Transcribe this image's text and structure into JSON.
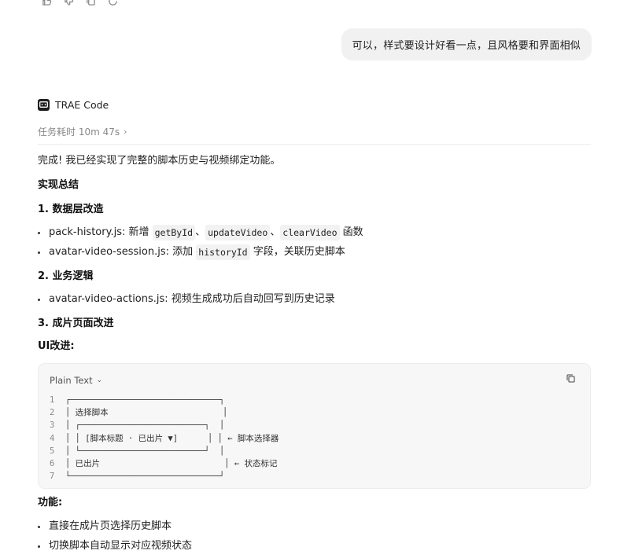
{
  "user_message": "可以，样式要设计好看一点，且风格要和界面相似",
  "assistant": {
    "brand_name": "TRAE Code",
    "duration": "任务耗时 10m 47s",
    "intro": "完成! 我已经实现了完整的脚本历史与视频绑定功能。",
    "summary_heading": "实现总结",
    "sections": {
      "data_layer": {
        "heading": "1. 数据层改造",
        "item1_file": "pack-history.js:",
        "item1_text_a": " 新增 ",
        "item1_code1": "getById",
        "item1_sep1": "、",
        "item1_code2": "updateVideo",
        "item1_sep2": "、",
        "item1_code3": "clearVideo",
        "item1_text_b": " 函数",
        "item2_file": "avatar-video-session.js:",
        "item2_text_a": " 添加 ",
        "item2_code": "historyId",
        "item2_text_b": " 字段，关联历史脚本"
      },
      "logic": {
        "heading": "2. 业务逻辑",
        "item1_file": "avatar-video-actions.js:",
        "item1_text": " 视频生成成功后自动回写到历史记录"
      },
      "page": {
        "heading": "3. 成片页面改进",
        "ui_label": "UI改进:"
      }
    },
    "code_block": {
      "language": "Plain Text",
      "lines": [
        {
          "num": "1",
          "text": "┌──────────────────────────────┐"
        },
        {
          "num": "2",
          "text": "│ 选择脚本                       │"
        },
        {
          "num": "3",
          "text": "│ ┌─────────────────────────┐  │"
        },
        {
          "num": "4",
          "text": "│ │ [脚本标题 · 已出片 ▼]      │ │ ← 脚本选择器"
        },
        {
          "num": "5",
          "text": "│ └─────────────────────────┘  │"
        },
        {
          "num": "6",
          "text": "│ 已出片                         │ ← 状态标记"
        },
        {
          "num": "7",
          "text": "└──────────────────────────────┘"
        }
      ]
    },
    "features_label": "功能:",
    "features": [
      "直接在成片页选择历史脚本",
      "切换脚本自动显示对应视频状态"
    ]
  }
}
